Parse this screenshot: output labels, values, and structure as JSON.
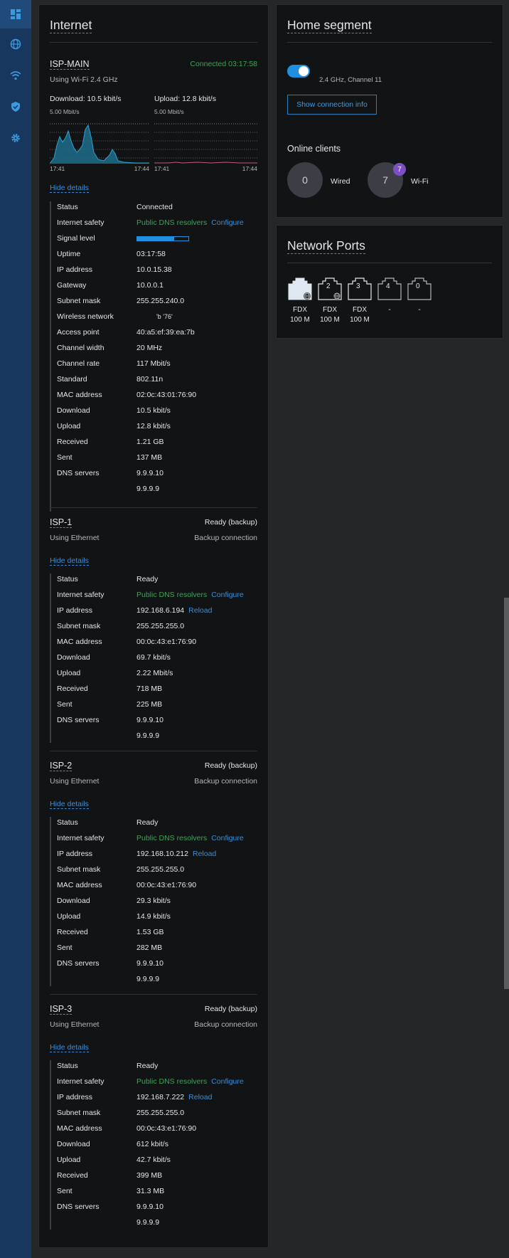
{
  "sidebar": {
    "items": [
      {
        "icon": "dashboard-icon",
        "active": true
      },
      {
        "icon": "globe-icon",
        "active": false
      },
      {
        "icon": "wifi-icon",
        "active": false
      },
      {
        "icon": "shield-icon",
        "active": false
      },
      {
        "icon": "gear-icon",
        "active": false
      }
    ]
  },
  "internet": {
    "title": "Internet",
    "isp_main": {
      "name": "ISP-MAIN",
      "status_header": "Connected 03:17:58",
      "subtitle": "Using Wi-Fi 2.4 GHz",
      "download_label": "Download: 10.5 kbit/s",
      "upload_label": "Upload: 12.8 kbit/s",
      "download_chart": {
        "ymax": "5.00 Mbit/s",
        "x_start": "17:41",
        "x_end": "17:44"
      },
      "upload_chart": {
        "ymax": "5.00 Mbit/s",
        "x_start": "17:41",
        "x_end": "17:44"
      },
      "hide_details": "Hide details",
      "signal_level": 0.72,
      "rows": {
        "status": {
          "label": "Status",
          "value": "Connected"
        },
        "safety": {
          "label": "Internet safety",
          "value": "Public DNS resolvers",
          "action": "Configure"
        },
        "signal": {
          "label": "Signal level"
        },
        "uptime": {
          "label": "Uptime",
          "value": "03:17:58"
        },
        "ip": {
          "label": "IP address",
          "value": "10.0.15.38"
        },
        "gateway": {
          "label": "Gateway",
          "value": "10.0.0.1"
        },
        "subnet": {
          "label": "Subnet mask",
          "value": "255.255.240.0"
        },
        "wireless": {
          "label": "Wireless network",
          "value": "'b        '76'"
        },
        "ap": {
          "label": "Access point",
          "value": "40:a5:ef:39:ea:7b"
        },
        "width": {
          "label": "Channel width",
          "value": "20 MHz"
        },
        "rate": {
          "label": "Channel rate",
          "value": "117 Mbit/s"
        },
        "standard": {
          "label": "Standard",
          "value": "802.11n"
        },
        "mac": {
          "label": "MAC address",
          "value": "02:0c:43:01:76:90"
        },
        "download": {
          "label": "Download",
          "value": "10.5 kbit/s"
        },
        "upload": {
          "label": "Upload",
          "value": "12.8 kbit/s"
        },
        "received": {
          "label": "Received",
          "value": "1.21 GB"
        },
        "sent": {
          "label": "Sent",
          "value": "137 MB"
        },
        "dns": {
          "label": "DNS servers",
          "value1": "9.9.9.10",
          "value2": "9.9.9.9"
        }
      }
    },
    "isp1": {
      "name": "ISP-1",
      "status_header": "Ready (backup)",
      "subtitle": "Using Ethernet",
      "role": "Backup connection",
      "hide_details": "Hide details",
      "rows": {
        "status": {
          "label": "Status",
          "value": "Ready"
        },
        "safety": {
          "label": "Internet safety",
          "value": "Public DNS resolvers",
          "action": "Configure"
        },
        "ip": {
          "label": "IP address",
          "value": "192.168.6.194",
          "action": "Reload"
        },
        "subnet": {
          "label": "Subnet mask",
          "value": "255.255.255.0"
        },
        "mac": {
          "label": "MAC address",
          "value": "00:0c:43:e1:76:90"
        },
        "download": {
          "label": "Download",
          "value": "69.7 kbit/s"
        },
        "upload": {
          "label": "Upload",
          "value": "2.22 Mbit/s"
        },
        "received": {
          "label": "Received",
          "value": "718 MB"
        },
        "sent": {
          "label": "Sent",
          "value": "225 MB"
        },
        "dns": {
          "label": "DNS servers",
          "value1": "9.9.9.10",
          "value2": "9.9.9.9"
        }
      }
    },
    "isp2": {
      "name": "ISP-2",
      "status_header": "Ready (backup)",
      "subtitle": "Using Ethernet",
      "role": "Backup connection",
      "hide_details": "Hide details",
      "rows": {
        "status": {
          "label": "Status",
          "value": "Ready"
        },
        "safety": {
          "label": "Internet safety",
          "value": "Public DNS resolvers",
          "action": "Configure"
        },
        "ip": {
          "label": "IP address",
          "value": "192.168.10.212",
          "action": "Reload"
        },
        "subnet": {
          "label": "Subnet mask",
          "value": "255.255.255.0"
        },
        "mac": {
          "label": "MAC address",
          "value": "00:0c:43:e1:76:90"
        },
        "download": {
          "label": "Download",
          "value": "29.3 kbit/s"
        },
        "upload": {
          "label": "Upload",
          "value": "14.9 kbit/s"
        },
        "received": {
          "label": "Received",
          "value": "1.53 GB"
        },
        "sent": {
          "label": "Sent",
          "value": "282 MB"
        },
        "dns": {
          "label": "DNS servers",
          "value1": "9.9.9.10",
          "value2": "9.9.9.9"
        }
      }
    },
    "isp3": {
      "name": "ISP-3",
      "status_header": "Ready (backup)",
      "subtitle": "Using Ethernet",
      "role": "Backup connection",
      "hide_details": "Hide details",
      "rows": {
        "status": {
          "label": "Status",
          "value": "Ready"
        },
        "safety": {
          "label": "Internet safety",
          "value": "Public DNS resolvers",
          "action": "Configure"
        },
        "ip": {
          "label": "IP address",
          "value": "192.168.7.222",
          "action": "Reload"
        },
        "subnet": {
          "label": "Subnet mask",
          "value": "255.255.255.0"
        },
        "mac": {
          "label": "MAC address",
          "value": "00:0c:43:e1:76:90"
        },
        "download": {
          "label": "Download",
          "value": "612 kbit/s"
        },
        "upload": {
          "label": "Upload",
          "value": "42.7 kbit/s"
        },
        "received": {
          "label": "Received",
          "value": "399 MB"
        },
        "sent": {
          "label": "Sent",
          "value": "31.3 MB"
        },
        "dns": {
          "label": "DNS servers",
          "value1": "9.9.9.10",
          "value2": "9.9.9.9"
        }
      }
    }
  },
  "home": {
    "title": "Home segment",
    "wifi_band": "2.4 GHz, Channel 11",
    "wifi_enabled": true,
    "show_info_button": "Show connection info",
    "online_clients_title": "Online clients",
    "wired_count": "0",
    "wired_label": "Wired",
    "wifi_count": "7",
    "wifi_badge": "7",
    "wifi_label": "Wi-Fi"
  },
  "ports": {
    "title": "Network Ports",
    "items": [
      {
        "label": "",
        "line1": "FDX",
        "line2": "100 M"
      },
      {
        "label": "2",
        "line1": "FDX",
        "line2": "100 M"
      },
      {
        "label": "3",
        "line1": "FDX",
        "line2": "100 M"
      },
      {
        "label": "4",
        "line1": "-",
        "line2": ""
      },
      {
        "label": "0",
        "line1": "-",
        "line2": ""
      }
    ]
  },
  "colors": {
    "accent": "#1f8fe0",
    "green": "#3aa657",
    "link": "#3c8ed6",
    "sidebar": "#17375e",
    "badge": "#7c4fc4"
  }
}
